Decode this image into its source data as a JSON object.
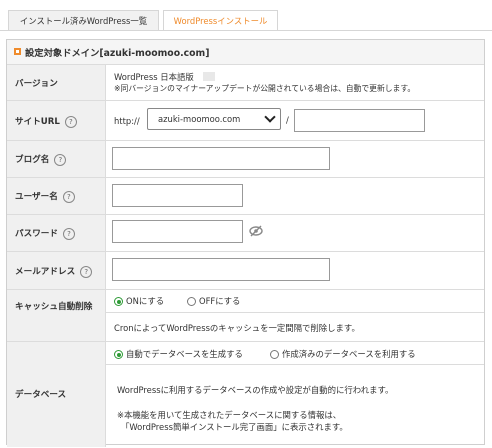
{
  "tabs": [
    {
      "label": "インストール済みWordPress一覧"
    },
    {
      "label": "WordPressインストール"
    }
  ],
  "panel": {
    "title": "設定対象ドメイン[azuki-moomoo.com]"
  },
  "rows": {
    "version": {
      "label": "バージョン",
      "value": "WordPress 日本語版",
      "note": "※同バージョンのマイナーアップデートが公開されている場合は、自動で更新します。"
    },
    "site_url": {
      "label": "サイトURL",
      "prefix": "http://",
      "domain": "azuki-moomoo.com",
      "slash": "/",
      "path": ""
    },
    "blog_name": {
      "label": "ブログ名",
      "value": ""
    },
    "user_name": {
      "label": "ユーザー名",
      "value": ""
    },
    "password": {
      "label": "パスワード",
      "value": ""
    },
    "email": {
      "label": "メールアドレス",
      "value": ""
    },
    "cache": {
      "label": "キャッシュ自動削除",
      "on_label": "ONにする",
      "off_label": "OFFにする",
      "selected": "ON",
      "note": "CronによってWordPressのキャッシュを一定間隔で削除します。"
    },
    "database": {
      "label": "データベース",
      "auto_label": "自動でデータベースを生成する",
      "existing_label": "作成済みのデータベースを利用する",
      "selected": "auto",
      "note1": "WordPressに利用するデータベースの作成や設定が自動的に行われます。",
      "note2": "※本機能を用いて生成されたデータベースに関する情報は、",
      "note3": "「WordPress簡単インストール完了画面」に表示されます。"
    }
  },
  "help_glyph": "?",
  "icons": {
    "help": "question-circle-icon",
    "eye": "eye-slash-icon",
    "header": "orange-square-icon"
  },
  "colors": {
    "accent": "#ef8b2c",
    "radio": "#2e9a36"
  }
}
